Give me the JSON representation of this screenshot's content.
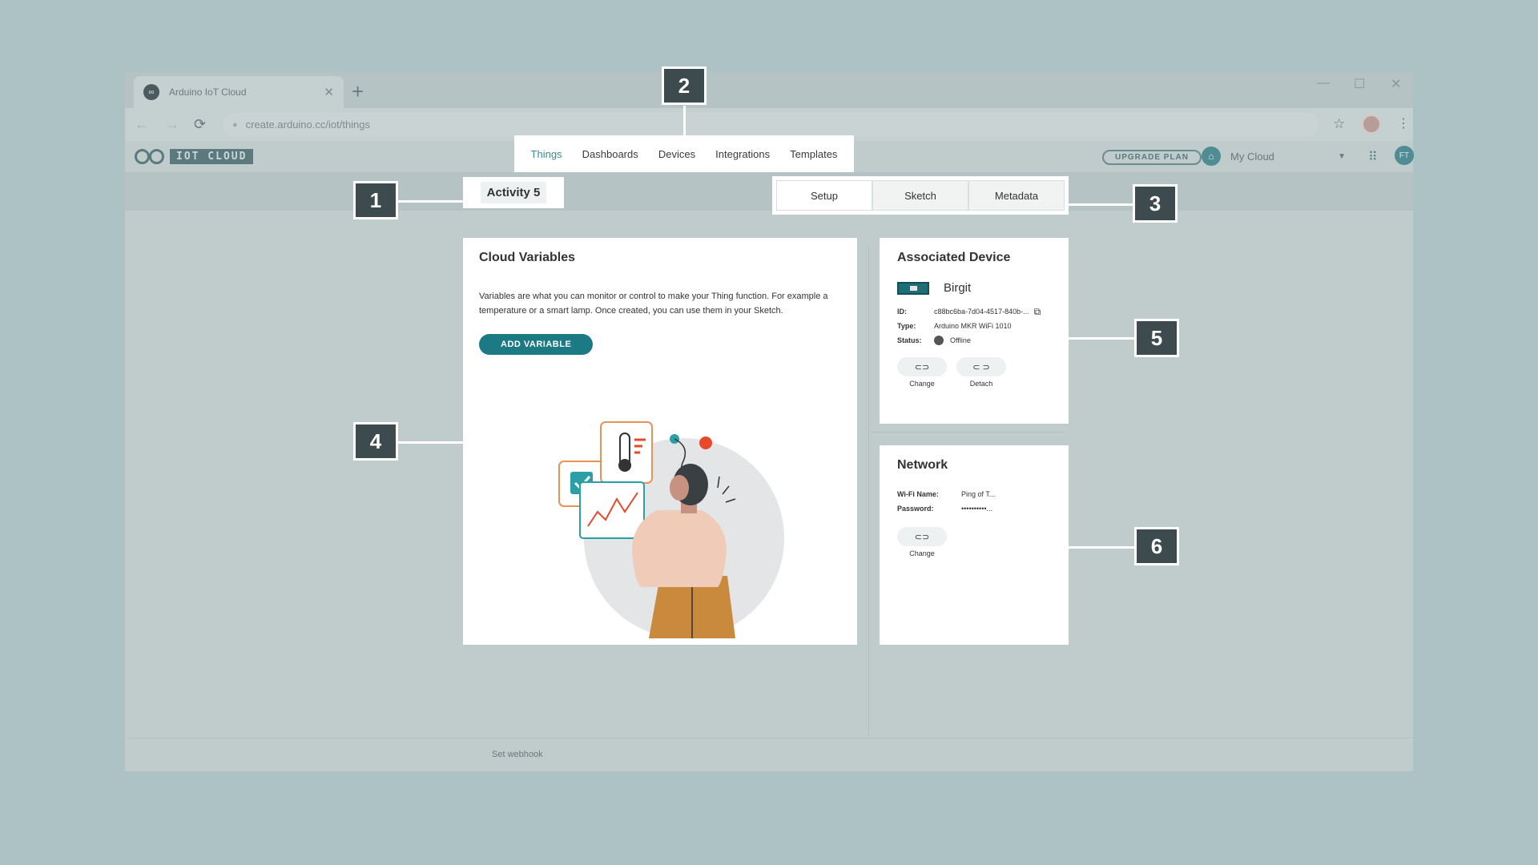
{
  "browser": {
    "tab_title": "Arduino IoT Cloud",
    "url": "create.arduino.cc/iot/things"
  },
  "app": {
    "logo_text": "IOT CLOUD",
    "nav": [
      {
        "label": "Things",
        "active": true
      },
      {
        "label": "Dashboards"
      },
      {
        "label": "Devices"
      },
      {
        "label": "Integrations"
      },
      {
        "label": "Templates"
      }
    ],
    "upgrade_label": "UPGRADE PLAN",
    "space_name": "My Cloud",
    "user_initials": "FT"
  },
  "thing": {
    "name": "Activity 5",
    "tabs": [
      {
        "label": "Setup",
        "active": true
      },
      {
        "label": "Sketch"
      },
      {
        "label": "Metadata"
      }
    ]
  },
  "cloud_variables": {
    "title": "Cloud Variables",
    "description": "Variables are what you can monitor or control to make your Thing function. For example a temperature or a smart lamp. Once created, you can use them in your Sketch.",
    "button_label": "ADD VARIABLE"
  },
  "associated_device": {
    "title": "Associated Device",
    "device_name": "Birgit",
    "id_key": "ID:",
    "id_value": "c88bc6ba-7d04-4517-840b-...",
    "type_key": "Type:",
    "type_value": "Arduino MKR WiFi 1010",
    "status_key": "Status:",
    "status_value": "Offline",
    "change_label": "Change",
    "detach_label": "Detach"
  },
  "network": {
    "title": "Network",
    "wifi_key": "Wi-Fi Name:",
    "wifi_value": "Ping of T...",
    "password_key": "Password:",
    "password_value": "••••••••••...",
    "change_label": "Change"
  },
  "footer": {
    "webhook_label": "Set webhook"
  },
  "callouts": {
    "c1": "1",
    "c2": "2",
    "c3": "3",
    "c4": "4",
    "c5": "5",
    "c6": "6"
  },
  "colors": {
    "background": "#adc2c4",
    "accent": "#1b7a83",
    "callout": "#3d4a4e"
  }
}
